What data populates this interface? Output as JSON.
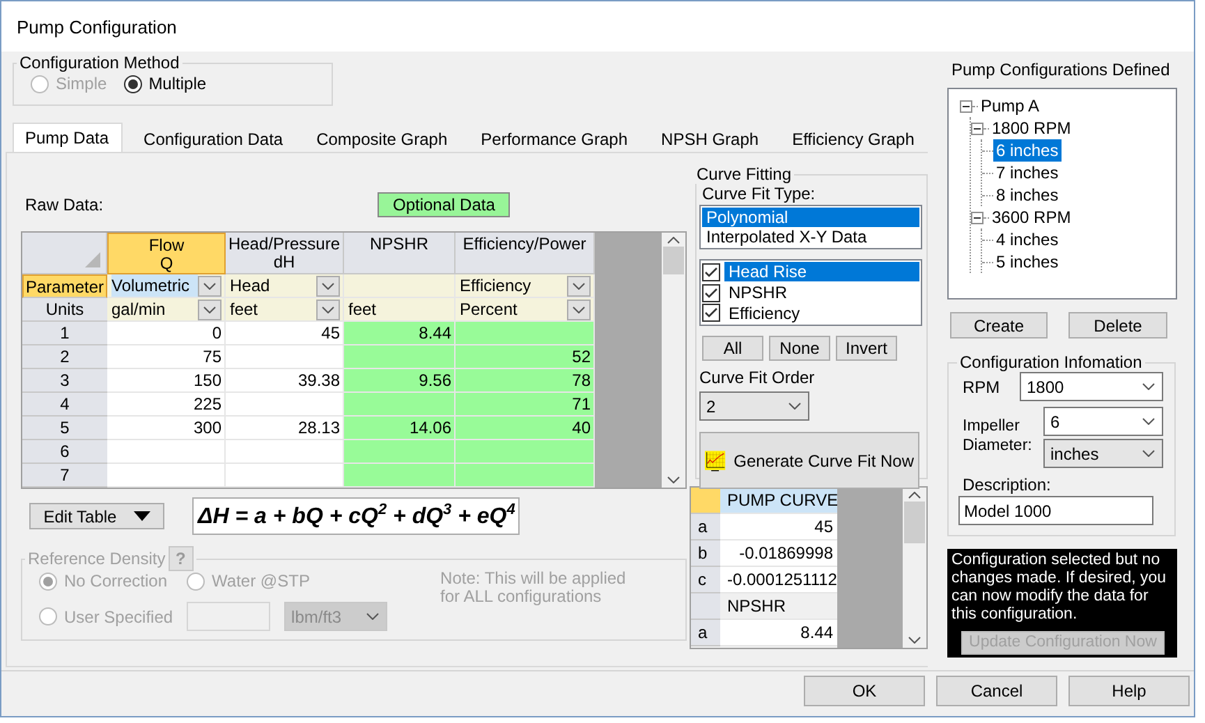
{
  "window": {
    "title": "Pump Configuration"
  },
  "configuration_method": {
    "label": "Configuration Method",
    "options": [
      {
        "label": "Simple",
        "selected": false,
        "disabled": true
      },
      {
        "label": "Multiple",
        "selected": true,
        "disabled": false
      }
    ]
  },
  "tabs": [
    {
      "label": "Pump Data",
      "selected": true
    },
    {
      "label": "Configuration Data",
      "selected": false
    },
    {
      "label": "Composite Graph",
      "selected": false
    },
    {
      "label": "Performance Graph",
      "selected": false
    },
    {
      "label": "NPSH Graph",
      "selected": false
    },
    {
      "label": "Efficiency Graph",
      "selected": false
    }
  ],
  "raw_data": {
    "label": "Raw Data:",
    "optional_badge": "Optional Data"
  },
  "table": {
    "parameter_label": "Parameter",
    "units_label": "Units",
    "columns": [
      {
        "title": "Flow",
        "subtitle": "Q",
        "selected": true,
        "optional": false,
        "parameter": "Volumetric",
        "parameter_selected": true,
        "units": "gal/min",
        "units_dropdown": true
      },
      {
        "title": "Head/Pressure",
        "subtitle": "dH",
        "selected": false,
        "optional": false,
        "parameter": "Head",
        "parameter_selected": false,
        "units": "feet",
        "units_dropdown": true
      },
      {
        "title": "NPSHR",
        "selected": false,
        "optional": true,
        "units": "feet",
        "units_dropdown": false
      },
      {
        "title": "Efficiency/Power",
        "selected": false,
        "optional": true,
        "parameter": "Efficiency",
        "parameter_selected": false,
        "units": "Percent",
        "units_dropdown": true
      }
    ],
    "rows": [
      {
        "label": "1",
        "cells": [
          "0",
          "45",
          "8.44",
          null
        ]
      },
      {
        "label": "2",
        "cells": [
          "75",
          null,
          null,
          "52"
        ]
      },
      {
        "label": "3",
        "cells": [
          "150",
          "39.38",
          "9.56",
          "78"
        ]
      },
      {
        "label": "4",
        "cells": [
          "225",
          null,
          null,
          "71"
        ]
      },
      {
        "label": "5",
        "cells": [
          "300",
          "28.13",
          "14.06",
          "40"
        ]
      },
      {
        "label": "6",
        "cells": [
          null,
          null,
          null,
          null
        ]
      },
      {
        "label": "7",
        "cells": [
          null,
          null,
          null,
          null
        ]
      }
    ]
  },
  "edit_table_button": "Edit Table",
  "formula": "ΔH = a + bQ + cQ$^{2}$ + dQ$^{3}$ + eQ$^{4}$",
  "reference_density": {
    "label": "Reference Density",
    "help": "?",
    "disabled": true,
    "options": [
      {
        "label": "No Correction",
        "selected": true
      },
      {
        "label": "Water @STP",
        "selected": false
      },
      {
        "label": "User Specified",
        "selected": false
      }
    ],
    "unit": "lbm/ft3",
    "note": "Note: This will be applied for ALL configurations"
  },
  "curve_fitting": {
    "label": "Curve Fitting",
    "type_label": "Curve Fit Type:",
    "types": [
      {
        "label": "Polynomial",
        "selected": true
      },
      {
        "label": "Interpolated X-Y Data",
        "selected": false
      }
    ],
    "curves": [
      {
        "label": "Head Rise",
        "checked": true,
        "selected": true
      },
      {
        "label": "NPSHR",
        "checked": true,
        "selected": false
      },
      {
        "label": "Efficiency",
        "checked": true,
        "selected": false
      }
    ],
    "buttons": [
      "All",
      "None",
      "Invert"
    ],
    "order_label": "Curve Fit Order",
    "order": "2",
    "generate_button": "Generate Curve Fit Now"
  },
  "coefficients": {
    "groups": [
      {
        "title": "PUMP CURVE",
        "selected": true,
        "rows": [
          {
            "label": "a",
            "value": "45"
          },
          {
            "label": "b",
            "value": "-0.01869998"
          },
          {
            "label": "c",
            "value": "-0.0001251112"
          }
        ]
      },
      {
        "title": "NPSHR",
        "selected": false,
        "rows": [
          {
            "label": "a",
            "value": "8.44"
          }
        ]
      }
    ]
  },
  "configurations": {
    "label": "Pump Configurations Defined",
    "tree": [
      {
        "label": "Pump A",
        "expanded": true,
        "selected": false,
        "children": [
          {
            "label": "1800 RPM",
            "expanded": true,
            "selected": false,
            "children": [
              {
                "label": "6 inches",
                "selected": true
              },
              {
                "label": "7 inches",
                "selected": false
              },
              {
                "label": "8 inches",
                "selected": false
              }
            ]
          },
          {
            "label": "3600 RPM",
            "expanded": true,
            "selected": false,
            "children": [
              {
                "label": "4 inches",
                "selected": false
              },
              {
                "label": "5 inches",
                "selected": false
              }
            ]
          }
        ]
      }
    ]
  },
  "create_button": "Create",
  "delete_button": "Delete",
  "configuration_information": {
    "label": "Configuration Infomation",
    "rpm_label": "RPM",
    "rpm": "1800",
    "impeller_label": "Impeller Diameter:",
    "impeller": "6",
    "impeller_unit": "inches",
    "description_label": "Description:",
    "description": "Model 1000"
  },
  "message": {
    "text": "Configuration selected but no changes made. If desired, you can now modify the data for this configuration.",
    "button": "Update Configuration Now",
    "button_disabled": true
  },
  "footer_buttons": [
    "OK",
    "Cancel",
    "Help"
  ]
}
